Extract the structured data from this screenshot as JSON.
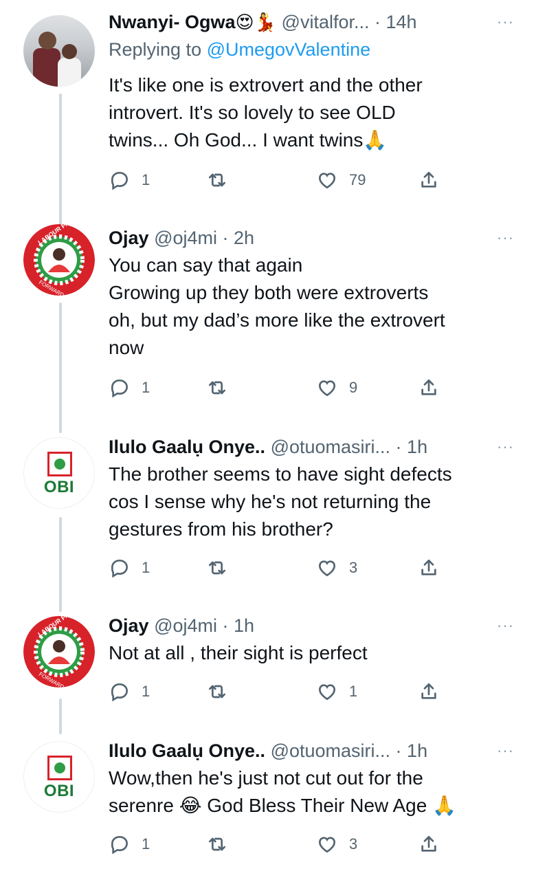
{
  "tweets": [
    {
      "name": "Nwanyi- Ogwa",
      "name_emoji": "😍💃",
      "handle": "@vitalfor...",
      "time": "14h",
      "more": "···",
      "replying_label": "Replying to ",
      "replying_mention": "@UmegovValentine",
      "text": [
        "It's like one is extrovert and the other",
        "introvert. It's so lovely to see OLD",
        "twins... Oh God... I want twins🙏"
      ],
      "counts": {
        "replies": "1",
        "retweets": "",
        "likes": "79"
      },
      "avatar": "photo-avatar"
    },
    {
      "name": "Ojay",
      "handle": "@oj4mi",
      "time": "2h",
      "more": "···",
      "text": [
        "You can say that again",
        "Growing up they both were extroverts",
        "oh, but my dad’s more like the extrovert",
        "now"
      ],
      "counts": {
        "replies": "1",
        "retweets": "",
        "likes": "9"
      },
      "avatar": "labour-party-avatar",
      "avatar_text": {
        "top": "LABOUR PARTY",
        "bottom": "FORWARD EVER"
      }
    },
    {
      "name": "Ilulo Gaalụ Onye..",
      "handle": "@otuomasiri...",
      "time": "1h",
      "more": "···",
      "text": [
        "The brother seems to have sight defects",
        "cos I sense why he's not returning the",
        "gestures from his brother?"
      ],
      "counts": {
        "replies": "1",
        "retweets": "",
        "likes": "3"
      },
      "avatar": "obi-avatar",
      "avatar_text": "OBI"
    },
    {
      "name": "Ojay",
      "handle": "@oj4mi",
      "time": "1h",
      "more": "···",
      "text": [
        "Not at all , their sight is perfect"
      ],
      "counts": {
        "replies": "1",
        "retweets": "",
        "likes": "1"
      },
      "avatar": "labour-party-avatar",
      "avatar_text": {
        "top": "LABOUR PARTY",
        "bottom": "FORWARD EVER"
      }
    },
    {
      "name": "Ilulo Gaalụ Onye..",
      "handle": "@otuomasiri...",
      "time": "1h",
      "more": "···",
      "text": [
        "Wow,then he's just not cut out for the",
        "serenre 😂 God Bless Their New Age 🙏"
      ],
      "counts": {
        "replies": "1",
        "retweets": "",
        "likes": "3"
      },
      "avatar": "obi-avatar",
      "avatar_text": "OBI"
    }
  ],
  "colors": {
    "link": "#1d9bf0",
    "secondary_text": "#536471",
    "thread_line": "#cfd9de",
    "labour_red": "#d7222a",
    "labour_green": "#2f9c46"
  }
}
